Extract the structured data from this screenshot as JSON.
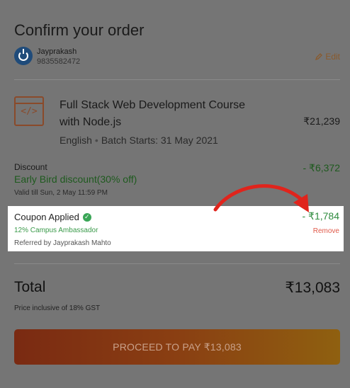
{
  "header": {
    "title": "Confirm your order"
  },
  "user": {
    "name": "Jayprakash",
    "phone": "9835582472",
    "edit_label": "Edit"
  },
  "course": {
    "icon_glyph": "</>",
    "title": "Full Stack Web Development Course with Node.js",
    "price": "₹21,239",
    "language": "English",
    "batch": "Batch Starts: 31 May 2021"
  },
  "discount": {
    "label": "Discount",
    "name": "Early Bird discount(30% off)",
    "valid_till": "Valid till Sun, 2 May 11:59 PM",
    "amount": "- ₹6,372"
  },
  "coupon": {
    "label": "Coupon Applied",
    "check_glyph": "✓",
    "code": "12% Campus Ambassador",
    "referred_by": "Referred by Jayprakash Mahto",
    "amount": "- ₹1,784",
    "remove_label": "Remove"
  },
  "total": {
    "label": "Total",
    "amount": "₹13,083",
    "tax_note": "Price inclusive of 18% GST"
  },
  "pay_button": {
    "label": "PROCEED TO PAY ₹13,083"
  },
  "colors": {
    "overlay": "#757575",
    "highlight": "#ffffff",
    "annotation_arrow": "#e0241c",
    "coupon_green": "#2e8b3e",
    "remove_red": "#e05a4a"
  },
  "icons": {
    "avatar": "power-logo-icon",
    "edit": "pencil-icon",
    "course": "code-window-icon",
    "verified": "check-circle-icon",
    "annotation": "curved-arrow-icon"
  }
}
